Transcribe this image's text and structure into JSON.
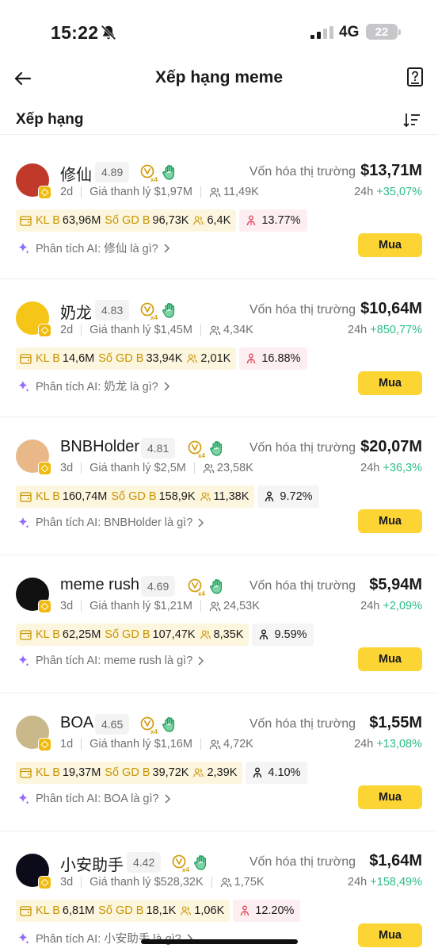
{
  "status_bar": {
    "time": "15:22",
    "network": "4G",
    "battery": "22"
  },
  "header": {
    "title": "Xếp hạng meme"
  },
  "section": {
    "title": "Xếp hạng"
  },
  "labels": {
    "market_cap": "Vốn hóa thị trường",
    "liquidity": "Giá thanh lý",
    "period": "24h",
    "volume_b": "KL B",
    "tx_b": "Số GD B",
    "buy": "Mua"
  },
  "coins": [
    {
      "name": "修仙",
      "score": "4.89",
      "age": "2d",
      "liquidity": "$1,97M",
      "holders": "11,49K",
      "market_cap": "$13,71M",
      "change": "+35,07%",
      "volume": "63,96M",
      "tx": "96,73K",
      "traders": "6,4K",
      "ratio": "13.77%",
      "ratio_tone": "red",
      "ai": "Phân tích AI: 修仙 là gì?",
      "avatar": "girl-portrait",
      "avatar_color": "#c0392b"
    },
    {
      "name": "奶龙",
      "score": "4.83",
      "age": "2d",
      "liquidity": "$1,45M",
      "holders": "4,34K",
      "market_cap": "$10,64M",
      "change": "+850,77%",
      "volume": "14,6M",
      "tx": "33,94K",
      "traders": "2,01K",
      "ratio": "16.88%",
      "ratio_tone": "red",
      "ai": "Phân tích AI: 奶龙 là gì?",
      "avatar": "yellow-dragon",
      "avatar_color": "#f5c518"
    },
    {
      "name": "BNBHolder",
      "score": "4.81",
      "age": "3d",
      "liquidity": "$2,5M",
      "holders": "23,58K",
      "market_cap": "$20,07M",
      "change": "+36,3%",
      "volume": "160,74M",
      "tx": "158,9K",
      "traders": "11,38K",
      "ratio": "9.72%",
      "ratio_tone": "grey",
      "ai": "Phân tích AI: BNBHolder là gì?",
      "avatar": "cartoon-man",
      "avatar_color": "#e8b888"
    },
    {
      "name": "meme rush",
      "score": "4.69",
      "age": "3d",
      "liquidity": "$1,21M",
      "holders": "24,53K",
      "market_cap": "$5,94M",
      "change": "+2,09%",
      "volume": "62,25M",
      "tx": "107,47K",
      "traders": "8,35K",
      "ratio": "9.59%",
      "ratio_tone": "grey",
      "ai": "Phân tích AI: meme rush là gì?",
      "avatar": "meme-rush-logo",
      "avatar_color": "#111111"
    },
    {
      "name": "BOA",
      "score": "4.65",
      "age": "1d",
      "liquidity": "$1,16M",
      "holders": "4,72K",
      "market_cap": "$1,55M",
      "change": "+13,08%",
      "volume": "19,37M",
      "tx": "39,72K",
      "traders": "2,39K",
      "ratio": "4.10%",
      "ratio_tone": "grey",
      "ai": "Phân tích AI: BOA là gì?",
      "avatar": "frog",
      "avatar_color": "#c9b98a"
    },
    {
      "name": "小安助手",
      "score": "4.42",
      "age": "3d",
      "liquidity": "$528,32K",
      "holders": "1,75K",
      "market_cap": "$1,64M",
      "change": "+158,49%",
      "volume": "6,81M",
      "tx": "18,1K",
      "traders": "1,06K",
      "ratio": "12.20%",
      "ratio_tone": "red",
      "ai": "Phân tích AI: 小安助手 là gì?",
      "avatar": "sparkle-logo",
      "avatar_color": "#0b0b1a"
    }
  ]
}
